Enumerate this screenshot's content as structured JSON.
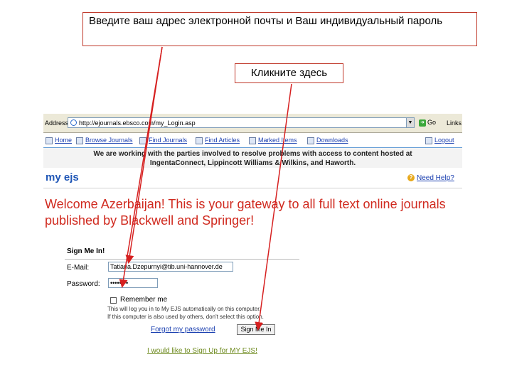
{
  "callouts": {
    "top": "Введите ваш адрес электронной почты и Ваш индивидуальный пароль",
    "mid": "Кликните здесь"
  },
  "browser": {
    "address_label": "Address",
    "url": "http://ejournals.ebsco.com/my_Login.asp",
    "go_label": "Go",
    "links_label": "Links"
  },
  "nav": {
    "items": [
      "Home",
      "Browse Journals",
      "Find Journals",
      "Find Articles",
      "Marked Items",
      "Downloads"
    ],
    "logout": "Logout"
  },
  "notice": {
    "line1": "We are working with the parties involved to resolve problems with access to content hosted at",
    "line2": "IngentaConnect, Lippincott Williams & Wilkins, and Haworth."
  },
  "brand": "my ejs",
  "help": "Need Help?",
  "welcome": "Welcome Azerbaijan! This is your gateway to all full text online journals published by Blackwell and Springer!",
  "signin": {
    "title": "Sign Me In!",
    "email_label": "E-Mail:",
    "email_value": "Tatiana.Dzepurnyi@tib.uni-hannover.de",
    "password_label": "Password:",
    "password_value": "••••••••",
    "remember_label": "Remember me",
    "fine1": "This will log you in to My EJS automatically on this computer.",
    "fine2": "If this computer is also used by others, don't select this option.",
    "forgot": "Forgot my password",
    "button": "Sign Me In",
    "signup": "I would like to Sign Up for MY EJS!"
  },
  "colors": {
    "arrow": "#d62020",
    "welcome": "#d02a1f",
    "brand": "#1f56b6",
    "link": "#1a3fb0"
  }
}
